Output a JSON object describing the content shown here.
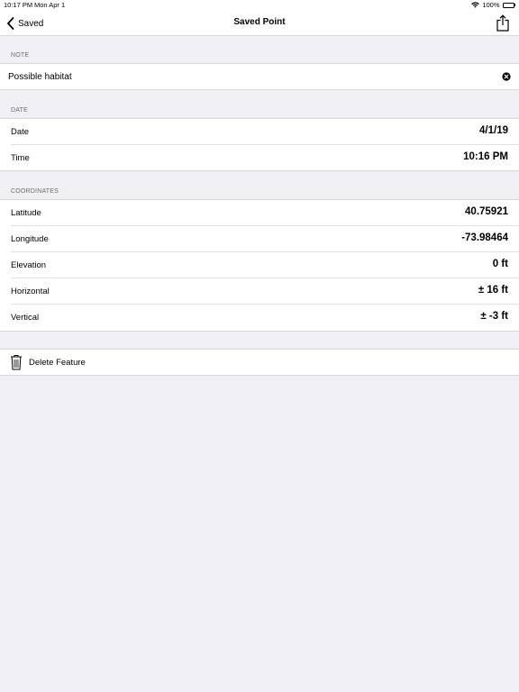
{
  "status_bar": {
    "time": "10:17 PM",
    "date": "Mon Apr 1",
    "battery_percent": "100%",
    "wifi_icon": "wifi-icon",
    "battery_icon": "battery-icon"
  },
  "nav": {
    "back_label": "Saved",
    "title": "Saved Point",
    "share_icon": "share-icon"
  },
  "note_section": {
    "header": "NOTE",
    "value": "Possible habitat",
    "clear_icon": "clear-icon"
  },
  "date_section": {
    "header": "DATE",
    "rows": [
      {
        "label": "Date",
        "value": "4/1/19"
      },
      {
        "label": "Time",
        "value": "10:16 PM"
      }
    ]
  },
  "coordinates_section": {
    "header": "COORDINATES",
    "rows": [
      {
        "label": "Latitude",
        "value": "40.75921"
      },
      {
        "label": "Longitude",
        "value": "-73.98464"
      },
      {
        "label": "Elevation",
        "value": "0 ft"
      },
      {
        "label": "Horizontal",
        "value": "± 16 ft"
      },
      {
        "label": "Vertical",
        "value": "± -3 ft"
      }
    ]
  },
  "actions": {
    "delete_label": "Delete Feature",
    "delete_icon": "trash-icon"
  }
}
